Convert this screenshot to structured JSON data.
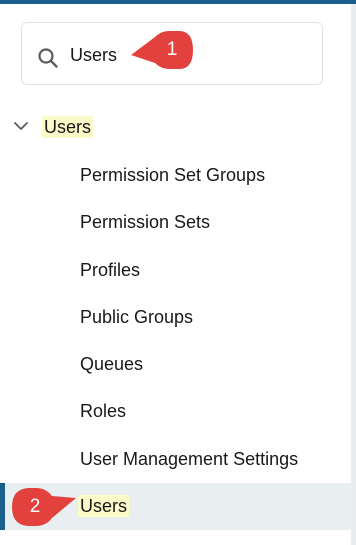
{
  "search": {
    "value": "Users"
  },
  "callouts": [
    "1",
    "2"
  ],
  "tree": {
    "parent_label": "Users",
    "items": [
      {
        "label": "Permission Set Groups"
      },
      {
        "label": "Permission Sets"
      },
      {
        "label": "Profiles"
      },
      {
        "label": "Public Groups"
      },
      {
        "label": "Queues"
      },
      {
        "label": "Roles"
      },
      {
        "label": "User Management Settings"
      },
      {
        "label": "Users",
        "selected": true
      }
    ]
  },
  "colors": {
    "accent": "#1b5f8c",
    "highlight": "#fbfbc9",
    "callout": "#e2413d",
    "selected_row": "#e9eef1"
  },
  "icons": {
    "search": "search-icon",
    "expand": "chevron-down-icon"
  }
}
